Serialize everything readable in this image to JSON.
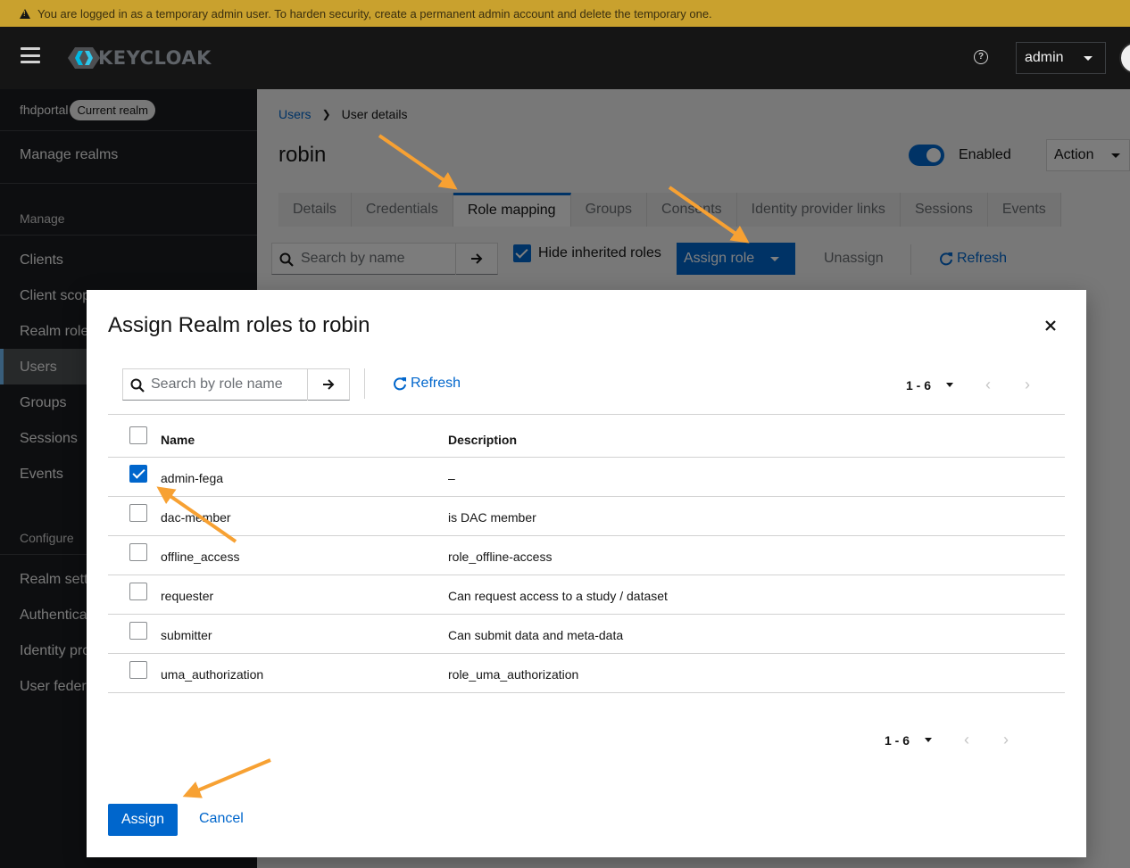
{
  "banner": {
    "text": "You are logged in as a temporary admin user. To harden security, create a permanent admin account and delete the temporary one."
  },
  "masthead": {
    "logo": "KEYCLOAK",
    "user": "admin"
  },
  "sidebar": {
    "realm": "fhdportal",
    "realm_badge": "Current realm",
    "manage_realms": "Manage realms",
    "section_manage": "Manage",
    "section_configure": "Configure",
    "items_manage": [
      "Clients",
      "Client scopes",
      "Realm roles",
      "Users",
      "Groups",
      "Sessions",
      "Events"
    ],
    "items_configure": [
      "Realm settings",
      "Authentication",
      "Identity providers",
      "User federation"
    ],
    "active": "Users"
  },
  "main": {
    "breadcrumb": {
      "link": "Users",
      "current": "User details"
    },
    "title": "robin",
    "enabled_label": "Enabled",
    "action_label": "Action",
    "tabs": [
      "Details",
      "Credentials",
      "Role mapping",
      "Groups",
      "Consents",
      "Identity provider links",
      "Sessions",
      "Events"
    ],
    "active_tab": "Role mapping",
    "search_placeholder": "Search by name",
    "hide_inherited": "Hide inherited roles",
    "assign_role": "Assign role",
    "unassign": "Unassign",
    "refresh": "Refresh"
  },
  "modal": {
    "title": "Assign Realm roles to robin",
    "search_placeholder": "Search by role name",
    "refresh": "Refresh",
    "pagination": "1 - 6",
    "columns": {
      "name": "Name",
      "description": "Description"
    },
    "rows": [
      {
        "name": "admin-fega",
        "description": "–",
        "checked": true
      },
      {
        "name": "dac-member",
        "description": "is DAC member",
        "checked": false
      },
      {
        "name": "offline_access",
        "description": "role_offline-access",
        "checked": false
      },
      {
        "name": "requester",
        "description": "Can request access to a study / dataset",
        "checked": false
      },
      {
        "name": "submitter",
        "description": "Can submit data and meta-data",
        "checked": false
      },
      {
        "name": "uma_authorization",
        "description": "role_uma_authorization",
        "checked": false
      }
    ],
    "assign_label": "Assign",
    "cancel_label": "Cancel"
  },
  "colors": {
    "primary": "#0066cc",
    "banner": "#c9a12e",
    "masthead": "#151515",
    "sidebar": "#1b1d21",
    "annotation": "#f7a133"
  }
}
